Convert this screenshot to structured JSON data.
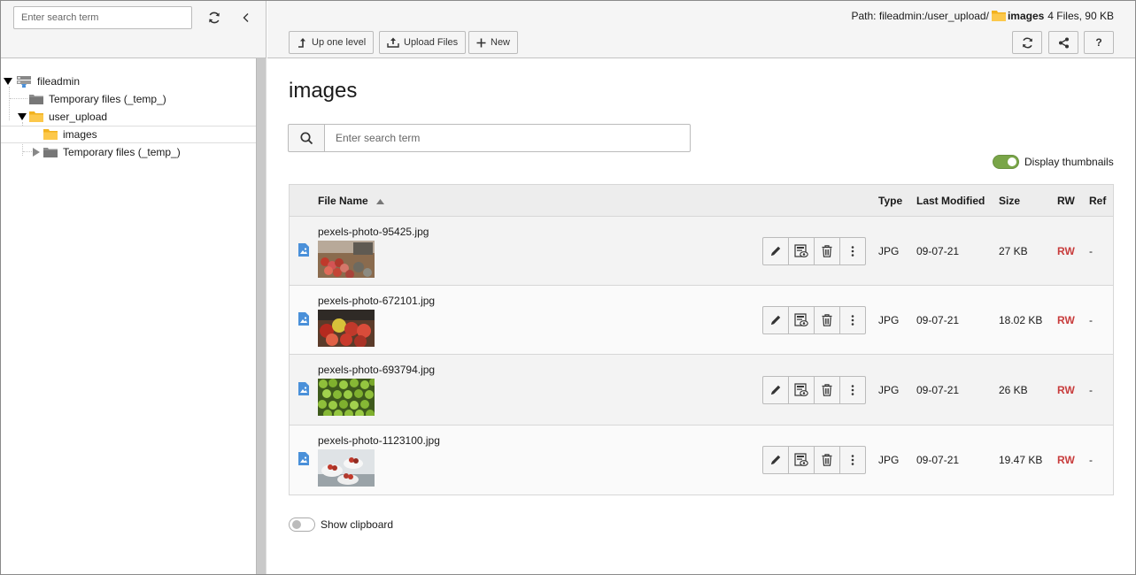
{
  "tree": {
    "search_placeholder": "Enter search term",
    "items": [
      {
        "label": "fileadmin"
      },
      {
        "label": "Temporary files (_temp_)"
      },
      {
        "label": "user_upload"
      },
      {
        "label": "images"
      },
      {
        "label": "Temporary files (_temp_)"
      }
    ]
  },
  "header": {
    "path_prefix": "Path: fileadmin:/user_upload/",
    "path_folder": "images",
    "path_info": "4 Files, 90 KB",
    "up_label": "Up one level",
    "upload_label": "Upload Files",
    "new_label": "New",
    "help_label": "?"
  },
  "main": {
    "title": "images",
    "search_placeholder": "Enter search term",
    "thumbnails_label": "Display thumbnails",
    "clipboard_label": "Show clipboard",
    "columns": {
      "name": "File Name",
      "type": "Type",
      "modified": "Last Modified",
      "size": "Size",
      "rw": "RW",
      "ref": "Ref"
    },
    "files": [
      {
        "name": "pexels-photo-95425.jpg",
        "type": "JPG",
        "modified": "09-07-21",
        "size": "27 KB",
        "rw": "RW",
        "ref": "-"
      },
      {
        "name": "pexels-photo-672101.jpg",
        "type": "JPG",
        "modified": "09-07-21",
        "size": "18.02 KB",
        "rw": "RW",
        "ref": "-"
      },
      {
        "name": "pexels-photo-693794.jpg",
        "type": "JPG",
        "modified": "09-07-21",
        "size": "26 KB",
        "rw": "RW",
        "ref": "-"
      },
      {
        "name": "pexels-photo-1123100.jpg",
        "type": "JPG",
        "modified": "09-07-21",
        "size": "19.47 KB",
        "rw": "RW",
        "ref": "-"
      }
    ]
  },
  "colors": {
    "rw": "#c83c3c",
    "toggle_on": "#79a548",
    "folder": "#f9c142",
    "file_icon": "#4a90d9"
  }
}
